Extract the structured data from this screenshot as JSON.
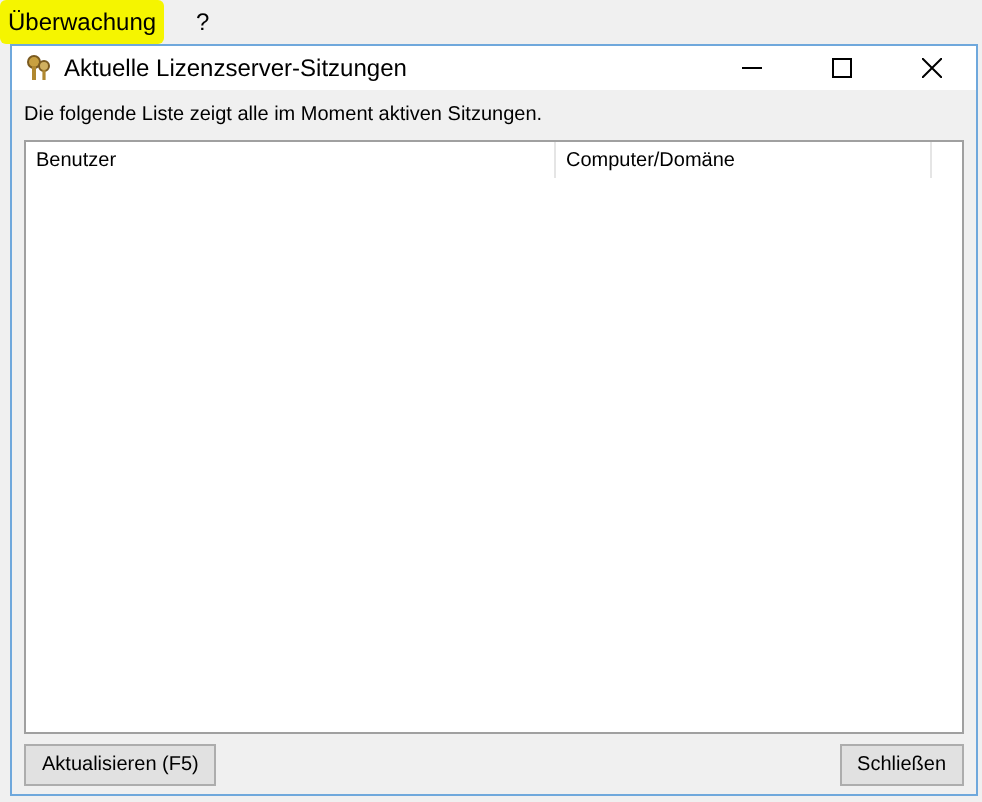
{
  "menu_bar": {
    "items": [
      {
        "label": "Überwachung",
        "highlighted": true
      },
      {
        "label": "?",
        "highlighted": false
      }
    ]
  },
  "dialog": {
    "title": "Aktuelle Lizenzserver-Sitzungen",
    "description": "Die folgende Liste zeigt alle im Moment aktiven Sitzungen.",
    "table": {
      "columns": [
        "Benutzer",
        "Computer/Domäne"
      ]
    },
    "buttons": [
      "Aktualisieren (F5)",
      "Schließen"
    ]
  }
}
